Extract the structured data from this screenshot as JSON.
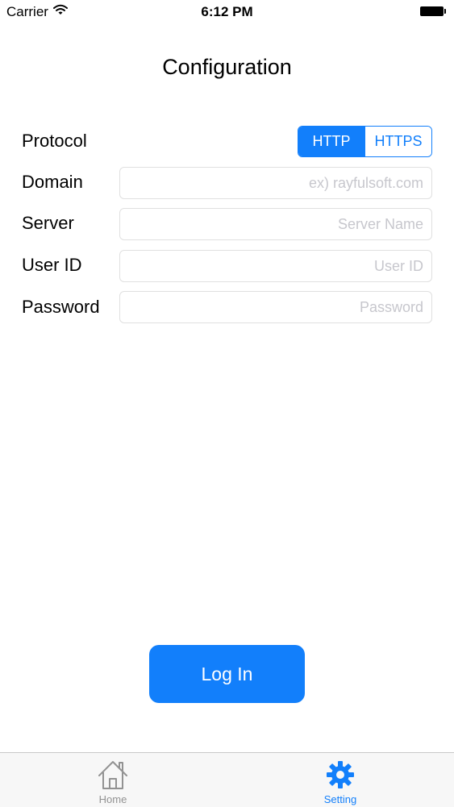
{
  "status_bar": {
    "carrier": "Carrier",
    "time": "6:12 PM"
  },
  "page": {
    "title": "Configuration"
  },
  "form": {
    "protocol": {
      "label": "Protocol",
      "options": [
        "HTTP",
        "HTTPS"
      ],
      "selected": "HTTP"
    },
    "domain": {
      "label": "Domain",
      "placeholder": "ex) rayfulsoft.com"
    },
    "server": {
      "label": "Server",
      "placeholder": "Server Name"
    },
    "user_id": {
      "label": "User ID",
      "placeholder": "User ID"
    },
    "password": {
      "label": "Password",
      "placeholder": "Password"
    }
  },
  "login_button": {
    "label": "Log In"
  },
  "tab_bar": {
    "home": {
      "label": "Home",
      "icon": "home-icon"
    },
    "setting": {
      "label": "Setting",
      "icon": "gear-icon",
      "active": true
    }
  },
  "colors": {
    "accent": "#127ffb",
    "placeholder": "#c7c7cd",
    "inactive_tab": "#929292"
  }
}
